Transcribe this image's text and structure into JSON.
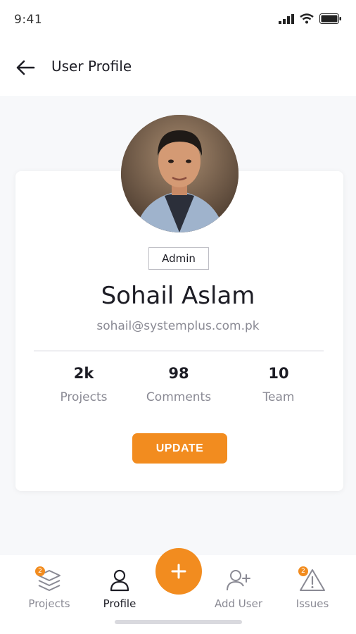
{
  "status_bar": {
    "time": "9:41"
  },
  "header": {
    "title": "User Profile"
  },
  "profile": {
    "role": "Admin",
    "name": "Sohail Aslam",
    "email": "sohail@systemplus.com.pk",
    "stats": [
      {
        "value": "2k",
        "label": "Projects"
      },
      {
        "value": "98",
        "label": "Comments"
      },
      {
        "value": "10",
        "label": "Team"
      }
    ],
    "update_label": "UPDATE"
  },
  "bottom_nav": {
    "items": [
      {
        "label": "Projects",
        "icon": "layers-icon",
        "badge": "2"
      },
      {
        "label": "Profile",
        "icon": "user-icon"
      },
      {
        "label": "Add User",
        "icon": "user-plus-icon"
      },
      {
        "label": "Issues",
        "icon": "warning-icon",
        "badge": "2"
      }
    ],
    "fab_icon": "plus-icon"
  },
  "colors": {
    "accent": "#f28c1f",
    "text": "#1d1d25",
    "muted": "#8a8a94"
  }
}
